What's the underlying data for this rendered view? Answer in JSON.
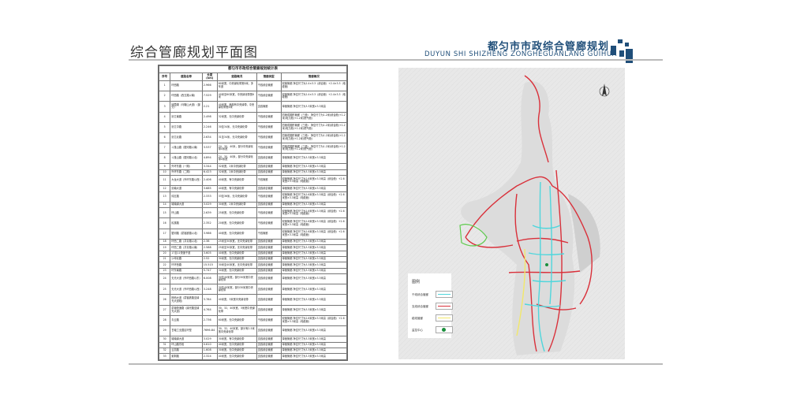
{
  "header": {
    "title": "综合管廊规划平面图",
    "brand_cn": "都匀市市政综合管廊规划",
    "brand_en": "DUYUN SHI SHIZHENG ZONGHEGUANLANG GUIHUA",
    "brand_color": "#1f4e79"
  },
  "table": {
    "caption": "都匀市市政综合管廊规划统计表",
    "headers": [
      "序号",
      "道路名称",
      "长度(km)",
      "道路概况",
      "管廊类型",
      "管廊概况"
    ],
    "rows": [
      [
        "1",
        "环西路",
        "2.966",
        "60米宽，中央绿化带宽6米，多车道",
        "干线综合管廊",
        "双舱管廊 净空尺寸为2.4×3.3（综合舱）+2.4×3.3（电缆舱）"
      ],
      [
        "2",
        "环西路（西五路以南）",
        "7.529",
        "40米至60米宽，中央绿化带宽6米",
        "干线综合管廊",
        "双舱管廊 净空尺寸为2.4×3.3（综合舱）+2.4×3.3（电缆舱）"
      ],
      [
        "3",
        "绿茵湖（马鞍山大道）（部分）",
        "2.21",
        "40米宽，局部有中央绿带，中央绿化带宽6米",
        "支线管廊",
        "单舱管廊 净空尺寸为3.3米宽×3.3米高"
      ],
      [
        "4",
        "剑江南路",
        "2.498",
        "32米宽，无中央绿化带",
        "干线综合管廊",
        "四舱成圆形管廊（三舱） 净空尺寸为1.2米(综合舱)+1.2米(电力舱)+1.2米(燃气舱)"
      ],
      [
        "5",
        "剑江中路",
        "2.246",
        "30至34米，无中央绿化带",
        "干线综合管廊",
        "四舱成圆形管廊（三舱） 净空尺寸为1.2米(综合舱)+1.2米(电力舱)+1.2米(燃气舱)"
      ],
      [
        "6",
        "剑江北路",
        "2.634",
        "31至34米，无中央绿化带",
        "干线综合管廊",
        "四舱成圆形管廊（三舱） 净空尺寸为1.2米(综合舱)+1.2米(电力舱)+1.2米(燃气舱)"
      ],
      [
        "7",
        "斗篷山路（银河路以南）",
        "3.537",
        "24、30、40米，部分中央绿化带4米宽",
        "干线综合管廊",
        "四舱成圆形管廊（三舱） 净空尺寸为1.2米(综合舱)+1.2米(电力舱)+1.2米(燃气舱)"
      ],
      [
        "8",
        "斗篷山路（银河路以北）",
        "4.894",
        "24、30、40米，部分中央绿化带4米宽",
        "支线综合管廊",
        "单舱管廊 净空尺寸为3.3米宽×3.3米高"
      ],
      [
        "9",
        "外环东路（一期）",
        "3.344",
        "32米宽，2米中央绿化带",
        "支线综合管廊",
        "单舱管廊 净空尺寸为3.3米宽×3.3米高"
      ],
      [
        "10",
        "外环东路（二期）",
        "6.423",
        "32米宽，2米中央绿化带",
        "支线综合管廊",
        "单舱管廊 净空尺寸为3.3米宽×3.3米高"
      ],
      [
        "11",
        "大龙大道（外环东路以西）",
        "2.406",
        "40米宽，有中央绿化带",
        "干线管廊",
        "双舱管廊 净空尺寸为2.6米宽×3.3米高（综合舱）+2.6米宽×3.3米高（电缆舱）"
      ],
      [
        "12",
        "剑南大道",
        "3.685",
        "40米宽，有中央绿化带",
        "支线综合管廊",
        "单舱管廊 净空尺寸为3.3米宽×3.3米高"
      ],
      [
        "13",
        "纬五路",
        "2.333",
        "33至36米，无中央绿化带",
        "干线综合管廊",
        "双舱管廊 净空尺寸为2.6米宽×3.3米高（综合舱）+2.6米宽×3.3米高（电缆舱）"
      ],
      [
        "14",
        "城南绿大道",
        "3.029",
        "30米宽，2米中央绿化带",
        "支线综合管廊",
        "单舱管廊 净空尺寸为3.3米宽×3.3米高"
      ],
      [
        "15",
        "环山路",
        "2.639",
        "25米宽，无中央绿化带",
        "干线综合管廊",
        "双舱管廊 净空尺寸为2.6米宽×3.3米高（综合舱）+2.6米宽×3.3米高（电缆舱）"
      ],
      [
        "16",
        "民族路",
        "2.352",
        "20米宽，无中央绿化带",
        "干线综合管廊",
        "双舱管廊 净空尺寸为2.6米宽×3.3米高（综合舱）+2.6米宽×3.3米高（电缆舱）"
      ],
      [
        "17",
        "银河路（蒙福铁路以北）",
        "3.986",
        "40米宽，无中央绿化带",
        "干线管廊",
        "双舱管廊 净空尺寸为2.6米宽×3.3米高（综合舱）+2.6米宽×3.3米高（电缆舱）"
      ],
      [
        "18",
        "环西二路（共青路以北）",
        "2.38",
        "25米至30米宽，无中央绿化带",
        "支线综合管廊",
        "单舱管廊 净空尺寸为3.3米宽×3.3米高"
      ],
      [
        "19",
        "环西二路（共青路以南）",
        "2.588",
        "25米至30米宽，无中央绿化带",
        "支线综合管廊",
        "单舱管廊 净空尺寸为3.3米宽×3.3米高"
      ],
      [
        "20",
        "17至11快速干道",
        "3.605",
        "40米宽，无中央绿化带",
        "支线综合管廊",
        "单舱管廊 净空尺寸为3.3米宽×3.3米高"
      ],
      [
        "21",
        "沙坪北路",
        "2.52",
        "30米宽，无中央绿化带",
        "支线综合管廊",
        "单舱管廊 净空尺寸为3.3米宽×3.3米高"
      ],
      [
        "22",
        "环环西路",
        "15.515",
        "30米至40米宽，无中央绿化带",
        "支线综合管廊",
        "单舱管廊 净空尺寸为3.3米宽×3.3米高"
      ],
      [
        "23",
        "环东南路",
        "5.747",
        "30米宽，无中央绿化带",
        "支线综合管廊",
        "单舱管廊 净空尺寸为3.3米宽×3.3米高"
      ],
      [
        "24",
        "无光大道（外环西路以东）",
        "6.008",
        "30至40米宽，部分30米宽中央绿化带",
        "支线综合管廊",
        "单舱管廊 净空尺寸为3.3米宽×3.3米高"
      ],
      [
        "25",
        "无光大道（外环西路以西）",
        "3.248",
        "30至40米宽，部分30米宽中央绿化带",
        "支线综合管廊",
        "单舱管廊 净空尺寸为3.3米宽×3.3米高"
      ],
      [
        "26",
        "杨西大道（蒙福铁路至绿光大道段）",
        "3.784",
        "40米宽，3米宽中央绿化带",
        "支线综合管廊",
        "单舱管廊 净空尺寸为3.3米宽×3.3米高"
      ],
      [
        "27",
        "蒙福快速路（绿光路至绿光大道）",
        "4.764",
        "30、32、40米宽，3米宽中央绿化带",
        "支线综合管廊",
        "单舱管廊 净空尺寸为3.3米宽×3.3米高"
      ],
      [
        "28",
        "青云路",
        "2.736",
        "60米宽，无中央绿化带",
        "干线综合管廊",
        "双舱管廊 净空尺寸为2.6米宽×3.3米高（综合舱）+2.6米宽×3.3米高（电缆舱）"
      ],
      [
        "29",
        "甘塘工业园区环型",
        "7696.84",
        "30、32、40米宽，部分有2.5米宽中央绿化带",
        "支线综合管廊",
        "单舱管廊 净空尺寸为3.3米宽×3.3米高"
      ],
      [
        "30",
        "城南绿大道",
        "3.029",
        "30米宽，有中央绿化带",
        "支线综合管廊",
        "单舱管廊 净空尺寸为3.3米宽×3.3米高"
      ],
      [
        "31",
        "环山路东段",
        "0.610",
        "40米宽，无中央绿化带",
        "支线综合管廊",
        "单舱管廊 净空尺寸为3.3米宽×3.3米高"
      ],
      [
        "32",
        "云凯路",
        "1.608",
        "30米宽，无中央绿化带",
        "支线综合管廊",
        "单舱管廊 净空尺寸为3.3米宽×3.3米高"
      ],
      [
        "33",
        "紫荆路",
        "2.324",
        "40米宽，无中央绿化带",
        "支线综合管廊",
        "单舱管廊 净空尺寸为3.3米宽×3.3米高"
      ]
    ]
  },
  "map": {
    "compass_icon": "north-arrow-icon",
    "legend": {
      "title": "图例",
      "items": [
        {
          "label": "干线综合管廊",
          "color": "#4fd6dc",
          "kind": "line"
        },
        {
          "label": "支线综合管廊",
          "color": "#d9303a",
          "kind": "line"
        },
        {
          "label": "缆线管廊",
          "color": "#f2e86a",
          "kind": "line"
        },
        {
          "label": "监控中心",
          "color": "#1a8f3c",
          "kind": "dot"
        }
      ]
    }
  }
}
